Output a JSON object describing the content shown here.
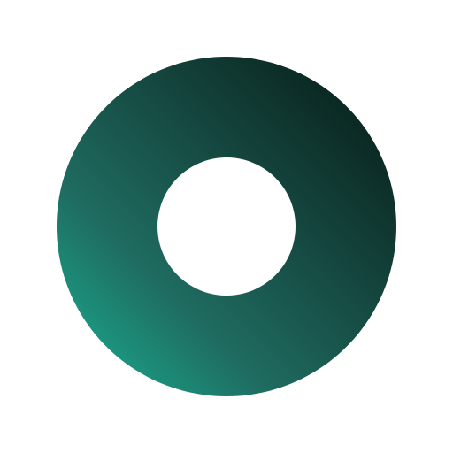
{
  "logo": {
    "icon": "ring-logo-icon",
    "colors": {
      "background": "#ffffff",
      "gradient_dark": "#061612",
      "gradient_mid": "#1f6b60",
      "gradient_light": "#18b596"
    }
  }
}
